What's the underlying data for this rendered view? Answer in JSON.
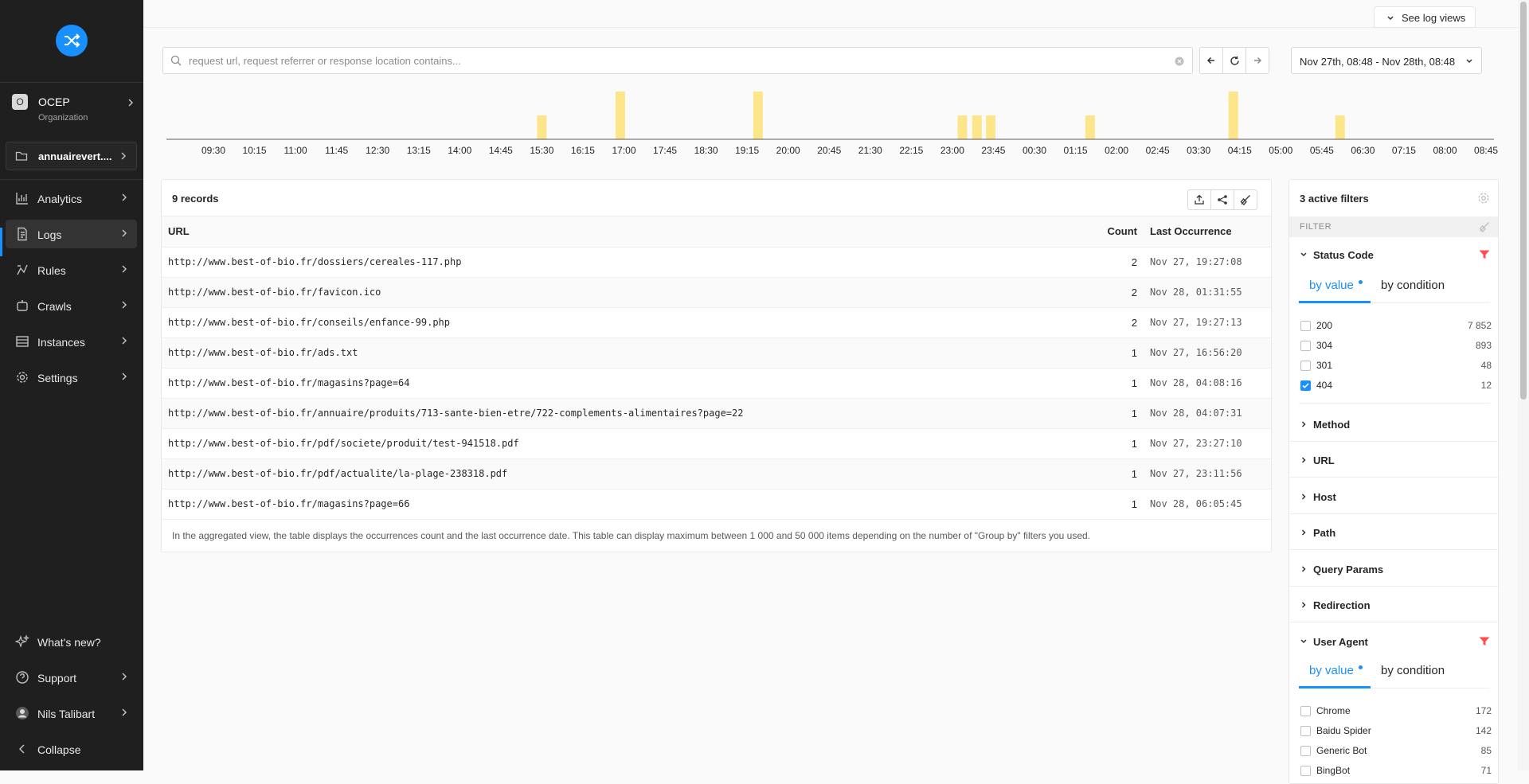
{
  "sidebar": {
    "org": {
      "badge": "O",
      "name": "OCEP",
      "sub": "Organization"
    },
    "project": {
      "name": "annuairevert...."
    },
    "items": [
      {
        "label": "Analytics",
        "icon": "bar-chart-icon"
      },
      {
        "label": "Logs",
        "icon": "document-icon"
      },
      {
        "label": "Rules",
        "icon": "rule-icon"
      },
      {
        "label": "Crawls",
        "icon": "robot-icon"
      },
      {
        "label": "Instances",
        "icon": "table-icon"
      },
      {
        "label": "Settings",
        "icon": "gear-icon"
      }
    ],
    "bottom": [
      {
        "label": "What's new?",
        "icon": "sparkle-icon"
      },
      {
        "label": "Support",
        "icon": "question-icon"
      },
      {
        "label": "Nils Talibart",
        "icon": "avatar"
      },
      {
        "label": "Collapse",
        "icon": "chevron-left-icon"
      }
    ]
  },
  "top": {
    "see_log_views": "See log views",
    "search_placeholder": "request url, request referrer or response location contains...",
    "date_range": "Nov 27th, 08:48 - Nov 28th, 08:48"
  },
  "histogram": {
    "ticks": [
      "09:30",
      "10:15",
      "11:00",
      "11:45",
      "12:30",
      "13:15",
      "14:00",
      "14:45",
      "15:30",
      "16:15",
      "17:00",
      "17:45",
      "18:30",
      "19:15",
      "20:00",
      "20:45",
      "21:30",
      "22:15",
      "23:00",
      "23:45",
      "00:30",
      "01:15",
      "02:00",
      "02:45",
      "03:30",
      "04:15",
      "05:00",
      "05:45",
      "06:30",
      "07:15",
      "08:00",
      "08:45"
    ],
    "bar_color": "#fde68a",
    "bars": [
      {
        "time": "15:30",
        "value": 1
      },
      {
        "time": "16:56",
        "value": 2
      },
      {
        "time": "19:27",
        "value": 2
      },
      {
        "time": "23:11",
        "value": 1
      },
      {
        "time": "23:27",
        "value": 1
      },
      {
        "time": "23:42",
        "value": 1
      },
      {
        "time": "01:31",
        "value": 1
      },
      {
        "time": "04:08",
        "value": 2
      },
      {
        "time": "06:05",
        "value": 1
      }
    ]
  },
  "table": {
    "records": "9 records",
    "columns": {
      "url": "URL",
      "count": "Count",
      "last": "Last Occurrence"
    },
    "rows": [
      {
        "url": "http://www.best-of-bio.fr/dossiers/cereales-117.php",
        "count": "2",
        "last": "Nov 27, 19:27:08"
      },
      {
        "url": "http://www.best-of-bio.fr/favicon.ico",
        "count": "2",
        "last": "Nov 28, 01:31:55"
      },
      {
        "url": "http://www.best-of-bio.fr/conseils/enfance-99.php",
        "count": "2",
        "last": "Nov 27, 19:27:13"
      },
      {
        "url": "http://www.best-of-bio.fr/ads.txt",
        "count": "1",
        "last": "Nov 27, 16:56:20"
      },
      {
        "url": "http://www.best-of-bio.fr/magasins?page=64",
        "count": "1",
        "last": "Nov 28, 04:08:16"
      },
      {
        "url": "http://www.best-of-bio.fr/annuaire/produits/713-sante-bien-etre/722-complements-alimentaires?page=22",
        "count": "1",
        "last": "Nov 28, 04:07:31"
      },
      {
        "url": "http://www.best-of-bio.fr/pdf/societe/produit/test-941518.pdf",
        "count": "1",
        "last": "Nov 27, 23:27:10"
      },
      {
        "url": "http://www.best-of-bio.fr/pdf/actualite/la-plage-238318.pdf",
        "count": "1",
        "last": "Nov 27, 23:11:56"
      },
      {
        "url": "http://www.best-of-bio.fr/magasins?page=66",
        "count": "1",
        "last": "Nov 28, 06:05:45"
      }
    ],
    "footer": "In the aggregated view, the table displays the occurrences count and the last occurrence date. This table can display maximum between 1 000 and 50 000 items depending on the number of \"Group by\" filters you used."
  },
  "filters": {
    "title": "3 active filters",
    "bar": "FILTER",
    "status_code": {
      "title": "Status Code",
      "tab_value": "by value",
      "tab_condition": "by condition",
      "options": [
        {
          "name": "200",
          "count": "7 852",
          "checked": false
        },
        {
          "name": "304",
          "count": "893",
          "checked": false
        },
        {
          "name": "301",
          "count": "48",
          "checked": false
        },
        {
          "name": "404",
          "count": "12",
          "checked": true
        }
      ]
    },
    "sections": [
      "Method",
      "URL",
      "Host",
      "Path",
      "Query Params",
      "Redirection"
    ],
    "user_agent": {
      "title": "User Agent",
      "tab_value": "by value",
      "tab_condition": "by condition",
      "options": [
        {
          "name": "Chrome",
          "count": "172",
          "checked": false
        },
        {
          "name": "Baidu Spider",
          "count": "142",
          "checked": false
        },
        {
          "name": "Generic Bot",
          "count": "85",
          "checked": false
        },
        {
          "name": "BingBot",
          "count": "71",
          "checked": false
        }
      ]
    },
    "funnel_color": "#ff4d4f",
    "accent": "#1890ff"
  }
}
